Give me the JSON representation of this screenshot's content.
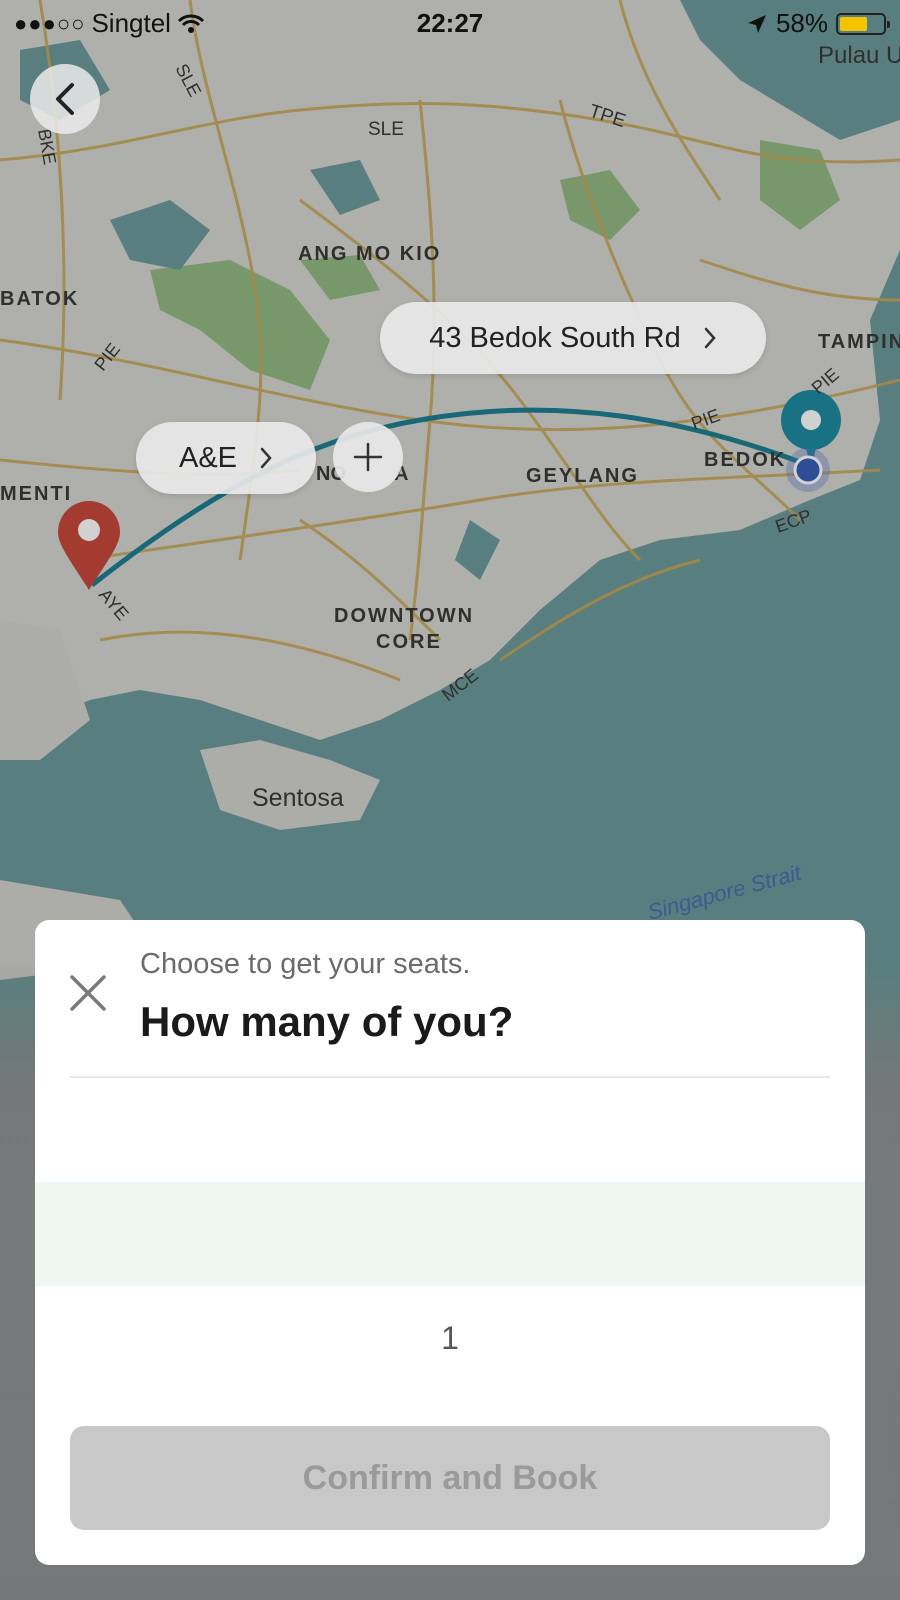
{
  "status_bar": {
    "signal_dots": "●●●○○",
    "carrier": "Singtel",
    "time": "22:27",
    "battery_percent": "58%",
    "battery_level": 0.58
  },
  "map": {
    "labels": {
      "pulau": "Pulau U",
      "sle_top": "SLE",
      "sle_left": "SLE",
      "bke": "BKE",
      "tpe": "TPE",
      "ang_mo_kio": "ANG MO KIO",
      "batok": "BATOK",
      "pie_left": "PIE",
      "tampin": "TAMPIN",
      "pie_right": "PIE",
      "pie_right2": "PIE",
      "geylang": "GEYLANG",
      "bedok": "BEDOK",
      "ecp": "ECP",
      "menti": "MENTI",
      "ayе": "AYE",
      "downtown": "DOWNTOWN",
      "core": "CORE",
      "mce": "MCE",
      "sentosa": "Sentosa",
      "strait": "Singapore Strait",
      "novena_frag": "NO",
      "novena_frag2": "A"
    },
    "icons": {
      "back": "chevron-left-icon",
      "origin_pin": "location-pin-icon",
      "dest_pin": "destination-pin-icon",
      "current": "current-location-icon"
    },
    "route_color": "#1f7f92",
    "pin_red": "#c9483c",
    "pin_teal": "#1f8ba0"
  },
  "chips": {
    "destination": "43 Bedok South Rd",
    "start": "A&E"
  },
  "sheet": {
    "subtitle": "Choose to get your seats.",
    "title": "How many of you?",
    "picker_value": "1",
    "confirm_label": "Confirm and Book"
  }
}
